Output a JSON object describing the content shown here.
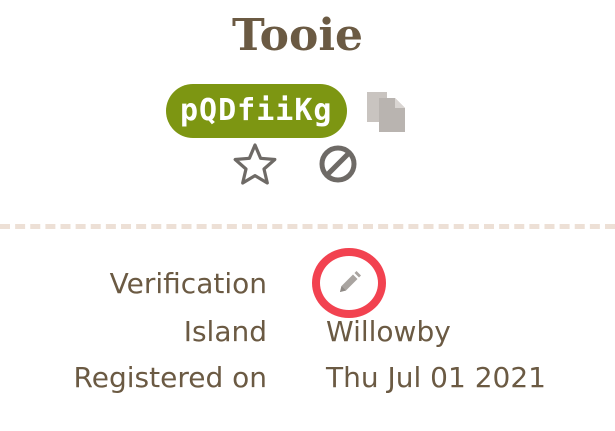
{
  "profile": {
    "name": "Tooie",
    "code": "pQDfiiKg"
  },
  "icons": {
    "copy": "copy-icon",
    "favorite": "star-outline-icon",
    "block": "block-icon",
    "edit": "pencil-icon"
  },
  "colors": {
    "accent": "#7d9612",
    "text": "#6b5a43",
    "highlight_ring": "#f24250",
    "divider": "#ede0d6"
  },
  "details": {
    "verification": {
      "label": "Verification",
      "value": ""
    },
    "island": {
      "label": "Island",
      "value": "Willowby"
    },
    "registered": {
      "label": "Registered on",
      "value": "Thu Jul 01 2021"
    }
  }
}
